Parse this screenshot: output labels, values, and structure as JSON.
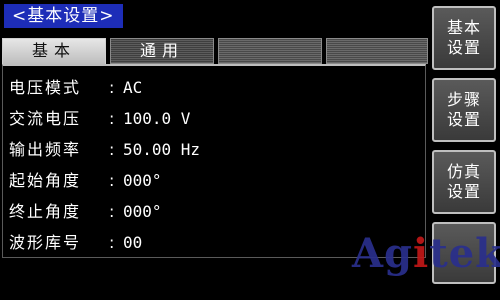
{
  "header": {
    "title": "<基本设置>"
  },
  "tabs": [
    {
      "label": "基本"
    },
    {
      "label": "通用"
    },
    {
      "label": ""
    },
    {
      "label": ""
    }
  ],
  "settings": [
    {
      "label": "电压模式",
      "sep": ":",
      "value": "AC"
    },
    {
      "label": "交流电压",
      "sep": ":",
      "value": "100.0 V"
    },
    {
      "label": "输出频率",
      "sep": ":",
      "value": "50.00 Hz"
    },
    {
      "label": "起始角度",
      "sep": ":",
      "value": "000°"
    },
    {
      "label": "终止角度",
      "sep": ":",
      "value": "000°"
    },
    {
      "label": "波形库号",
      "sep": ":",
      "value": "00"
    }
  ],
  "side_buttons": [
    {
      "line1": "基本",
      "line2": "设置"
    },
    {
      "line1": "步骤",
      "line2": "设置"
    },
    {
      "line1": "仿真",
      "line2": "设置"
    },
    {
      "line1": "",
      "line2": ""
    }
  ],
  "logo": {
    "prefix": "Ag",
    "accent": "i",
    "suffix": "tek"
  },
  "colors": {
    "title_bg": "#1d2db8",
    "logo_main": "#2a2f8c",
    "logo_accent": "#c01717"
  }
}
